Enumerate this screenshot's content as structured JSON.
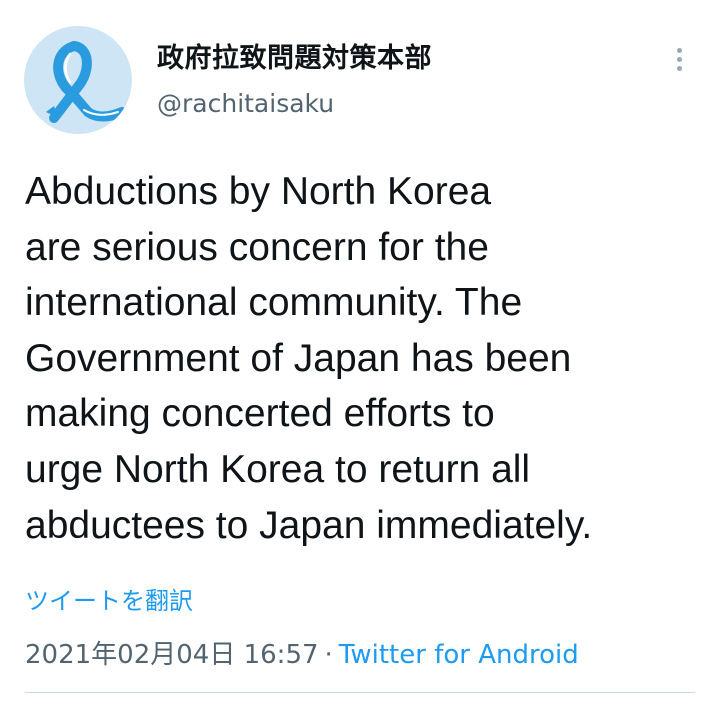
{
  "author": {
    "display_name": "政府拉致問題対策本部",
    "handle": "@rachitaisaku",
    "avatar_icon": "blue-ribbon-icon",
    "avatar_background": "#cde5f5",
    "ribbon_color": "#2b9be0"
  },
  "menu": {
    "icon": "more-vertical-icon"
  },
  "tweet": {
    "text_lines": [
      "Abductions by North Korea",
      "are serious concern for the",
      "international community. The",
      "Government of Japan has been",
      "making concerted efforts to",
      "urge North Korea to return all",
      "abductees to Japan immediately."
    ],
    "translate_label": "ツイートを翻訳",
    "timestamp": "2021年02月04日 16:57",
    "separator": "·",
    "source": "Twitter for Android"
  },
  "colors": {
    "link": "#1d9bf0",
    "secondary_text": "#536471",
    "primary_text": "#0f1419",
    "divider": "#cfd9de"
  }
}
